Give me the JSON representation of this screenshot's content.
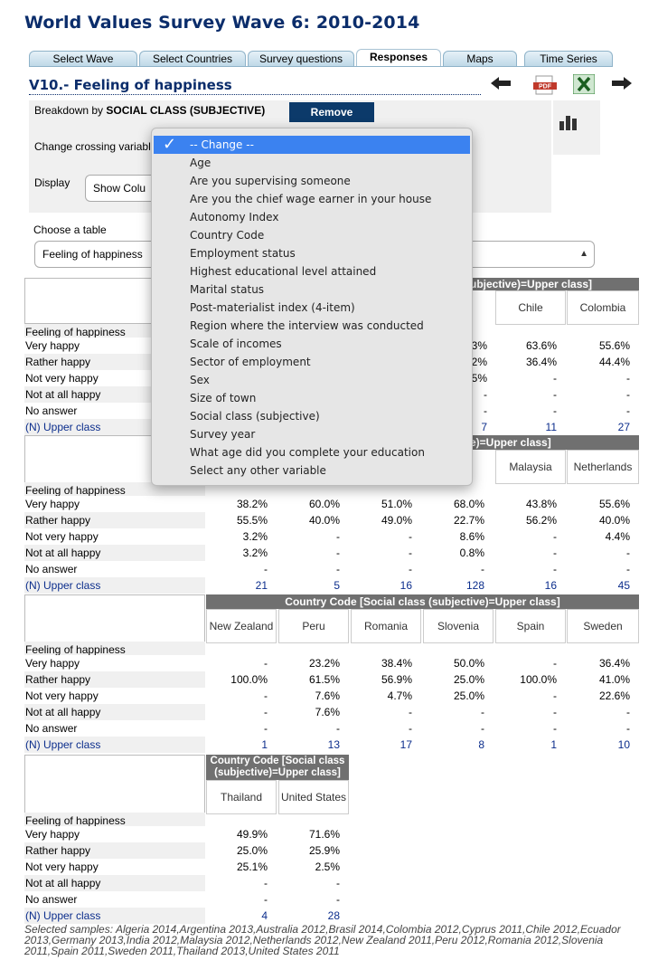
{
  "page_title": "World Values Survey Wave 6: 2010-2014",
  "tabs": [
    "Select Wave",
    "Select Countries",
    "Survey questions",
    "Responses",
    "Maps",
    "Time Series"
  ],
  "active_tab": "Responses",
  "question_title": "V10.- Feeling of happiness",
  "breakdown": {
    "label": "Breakdown by",
    "variable": "SOCIAL CLASS (SUBJECTIVE)",
    "remove_label": "Remove"
  },
  "crossing_label": "Change crossing variabl",
  "display": {
    "label": "Display",
    "value": "Show Colu"
  },
  "choose_table": {
    "label": "Choose a table",
    "value": "Feeling of happiness"
  },
  "dropdown": {
    "selected": "-- Change --",
    "options": [
      "Age",
      "Are you supervising someone",
      "Are you the chief wage earner in your house",
      "Autonomy Index",
      "Country Code",
      "Employment status",
      "Highest educational level attained",
      "Marital status",
      "Post-materialist index (4-item)",
      "Region where the interview was conducted",
      "Scale of incomes",
      "Sector of employment",
      "Sex",
      "Size of town",
      "Social class (subjective)",
      "Survey year",
      "What age did you complete your education",
      "Select any other variable"
    ]
  },
  "row_labels": {
    "section": "Feeling of happiness",
    "rows": [
      "Very happy",
      "Rather happy",
      "Not very happy",
      "Not at all happy",
      "No answer"
    ],
    "n_label": "(N) Upper class"
  },
  "table1": {
    "group_header": "ubjective)=Upper class]",
    "columns": [
      "Chile",
      "Colombia"
    ],
    "partial_column": [
      "3%",
      "2%",
      "5%",
      "-",
      "-",
      "7"
    ],
    "values": [
      [
        "63.6%",
        "55.6%"
      ],
      [
        "36.4%",
        "44.4%"
      ],
      [
        "-",
        "-"
      ],
      [
        "-",
        "-"
      ],
      [
        "-",
        "-"
      ]
    ],
    "n": [
      "11",
      "27"
    ]
  },
  "table2": {
    "group_header": "e)=Upper class]",
    "columns": [
      "Malaysia",
      "Netherlands"
    ],
    "values": [
      [
        "38.2%",
        "60.0%",
        "51.0%",
        "68.0%",
        "43.8%",
        "55.6%"
      ],
      [
        "55.5%",
        "40.0%",
        "49.0%",
        "22.7%",
        "56.2%",
        "40.0%"
      ],
      [
        "3.2%",
        "-",
        "-",
        "8.6%",
        "-",
        "4.4%"
      ],
      [
        "3.2%",
        "-",
        "-",
        "0.8%",
        "-",
        "-"
      ],
      [
        "-",
        "-",
        "-",
        "-",
        "-",
        "-"
      ]
    ],
    "n": [
      "21",
      "5",
      "16",
      "128",
      "16",
      "45"
    ]
  },
  "table3": {
    "group_header": "Country Code [Social class (subjective)=Upper class]",
    "columns": [
      "New Zealand",
      "Peru",
      "Romania",
      "Slovenia",
      "Spain",
      "Sweden"
    ],
    "values": [
      [
        "-",
        "23.2%",
        "38.4%",
        "50.0%",
        "-",
        "36.4%"
      ],
      [
        "100.0%",
        "61.5%",
        "56.9%",
        "25.0%",
        "100.0%",
        "41.0%"
      ],
      [
        "-",
        "7.6%",
        "4.7%",
        "25.0%",
        "-",
        "22.6%"
      ],
      [
        "-",
        "7.6%",
        "-",
        "-",
        "-",
        "-"
      ],
      [
        "-",
        "-",
        "-",
        "-",
        "-",
        "-"
      ]
    ],
    "n": [
      "1",
      "13",
      "17",
      "8",
      "1",
      "10"
    ]
  },
  "table4": {
    "group_header": "Country Code [Social class (subjective)=Upper class]",
    "columns": [
      "Thailand",
      "United States"
    ],
    "values": [
      [
        "49.9%",
        "71.6%"
      ],
      [
        "25.0%",
        "25.9%"
      ],
      [
        "25.1%",
        "2.5%"
      ],
      [
        "-",
        "-"
      ],
      [
        "-",
        "-"
      ]
    ],
    "n": [
      "4",
      "28"
    ]
  },
  "selected_samples": "Selected samples: Algeria 2014,Argentina 2013,Australia 2012,Brasil 2014,Colombia 2012,Cyprus 2011,Chile 2012,Ecuador 2013,Germany 2013,India 2012,Malaysia 2012,Netherlands 2012,New Zealand 2011,Peru 2012,Romania 2012,Slovenia 2011,Spain 2011,Sweden 2011,Thailand 2013,United States 2011"
}
